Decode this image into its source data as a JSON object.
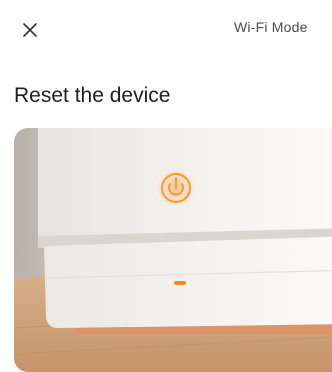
{
  "header": {
    "close_icon": "close-icon",
    "title": "Wi-Fi Mode"
  },
  "main": {
    "title": "Reset the device",
    "image": {
      "subject": "device-photo",
      "power_icon": "power-icon",
      "accent_color": "#f2a03d",
      "status_light_color": "#f08a24"
    }
  },
  "colors": {
    "background": "#ffffff",
    "text": "#1f1f1f",
    "muted_text": "#4a4a4a"
  }
}
